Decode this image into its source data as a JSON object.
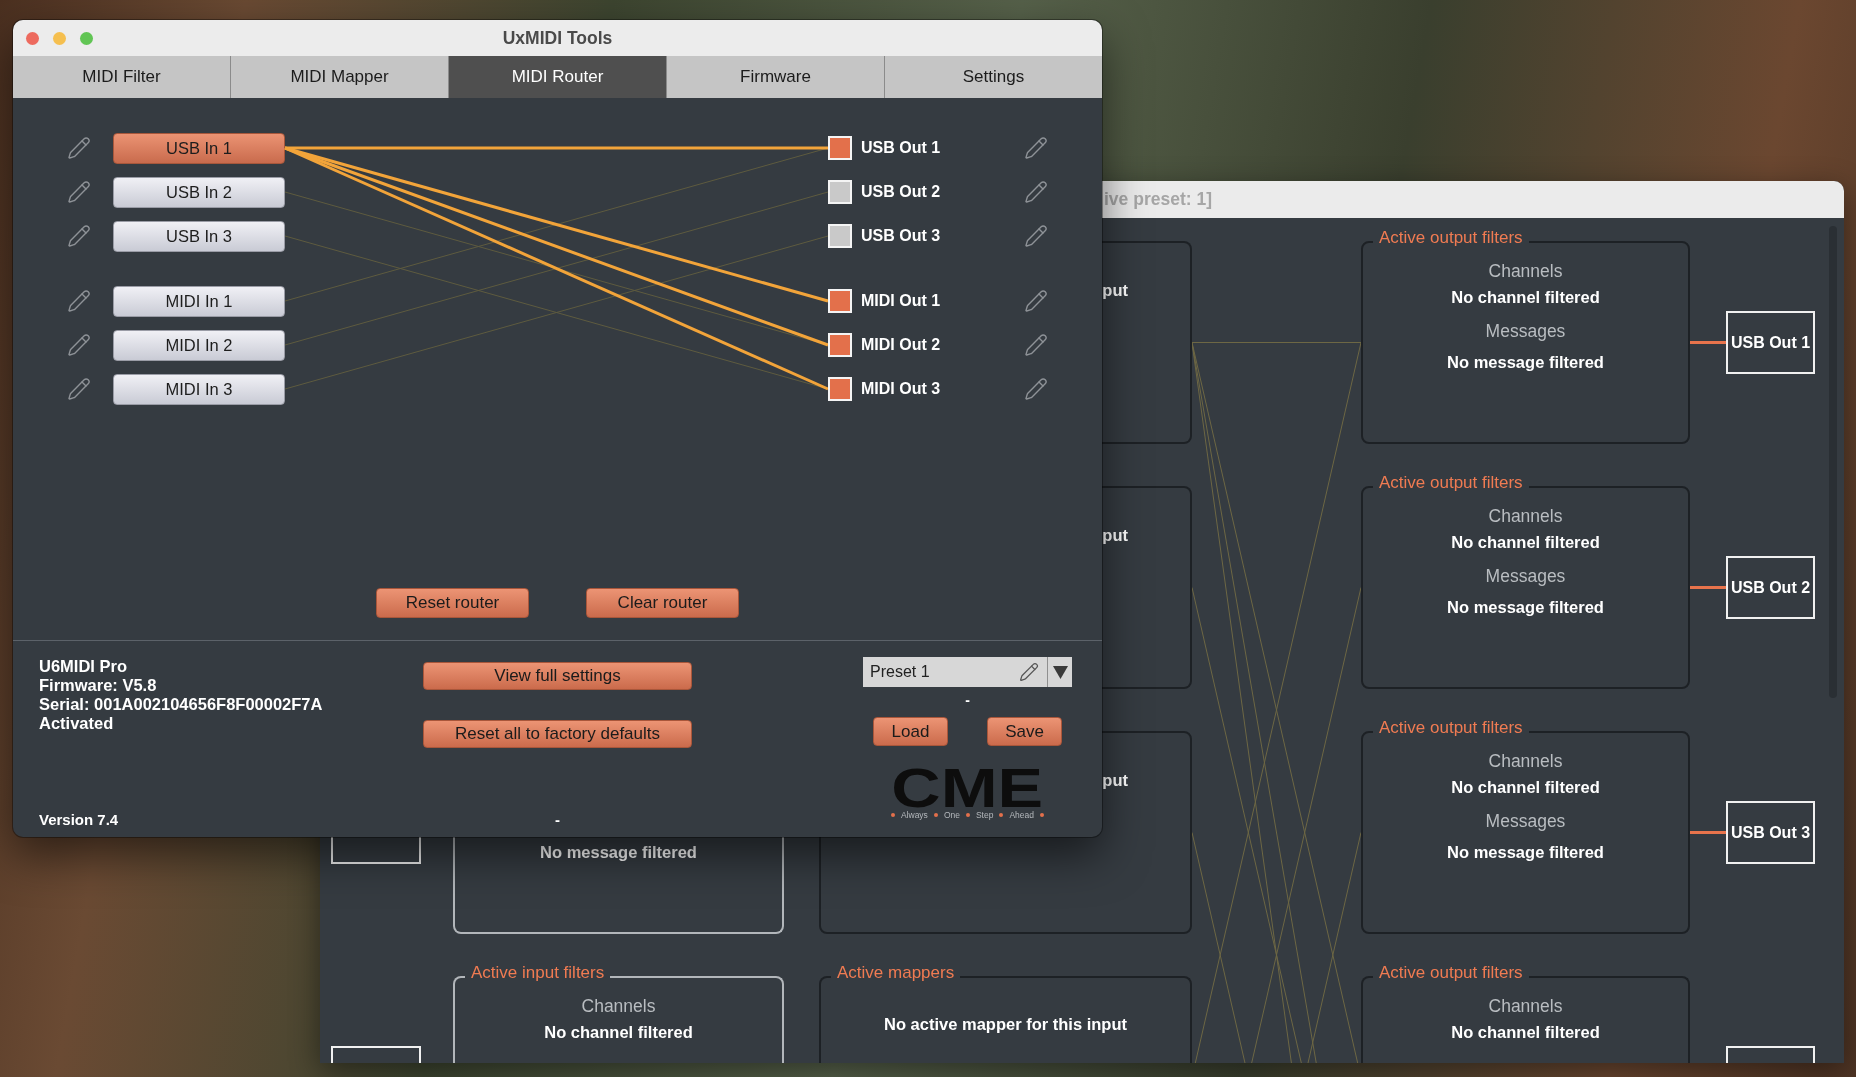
{
  "main_window": {
    "title": "UxMIDI Tools",
    "tabs": [
      {
        "label": "MIDI Filter",
        "selected": false
      },
      {
        "label": "MIDI Mapper",
        "selected": false
      },
      {
        "label": "MIDI Router",
        "selected": true
      },
      {
        "label": "Firmware",
        "selected": false
      },
      {
        "label": "Settings",
        "selected": false
      }
    ],
    "router": {
      "input_groups": [
        [
          {
            "label": "USB In 1",
            "selected": true
          },
          {
            "label": "USB In 2",
            "selected": false
          },
          {
            "label": "USB In 3",
            "selected": false
          }
        ],
        [
          {
            "label": "MIDI In 1",
            "selected": false
          },
          {
            "label": "MIDI In 2",
            "selected": false
          },
          {
            "label": "MIDI In 3",
            "selected": false
          }
        ]
      ],
      "output_groups": [
        [
          {
            "label": "USB Out 1",
            "checked": true
          },
          {
            "label": "USB Out 2",
            "checked": false
          },
          {
            "label": "USB Out 3",
            "checked": false
          }
        ],
        [
          {
            "label": "MIDI Out 1",
            "checked": true
          },
          {
            "label": "MIDI Out 2",
            "checked": true
          },
          {
            "label": "MIDI Out 3",
            "checked": true
          }
        ]
      ],
      "buttons": [
        "Reset router",
        "Clear router"
      ]
    },
    "device_info": [
      "U6MIDI Pro",
      "Firmware: V5.8",
      "Serial: 001A002104656F8F00002F7A",
      "Activated"
    ],
    "version": "Version 7.4",
    "actions": [
      "View full settings",
      "Reset all to factory defaults"
    ],
    "actions_status": "-",
    "preset": {
      "value": "Preset 1"
    },
    "preset_status": "-",
    "preset_buttons": [
      "Load",
      "Save"
    ],
    "logo": {
      "text": "CME",
      "tagline": [
        "Always",
        "One",
        "Step",
        "Ahead"
      ]
    }
  },
  "background_window": {
    "title": "ive preset: 1]",
    "rows": [
      {
        "mapper": {
          "kind": "covered",
          "text": "put"
        },
        "output_filter": {
          "title": "Active output filters",
          "channels_label": "Channels",
          "channels_value": "No channel filtered",
          "messages_label": "Messages",
          "messages_value": "No message filtered"
        },
        "output_node": {
          "kind": "labelled",
          "label": "USB Out 1"
        }
      },
      {
        "mapper": {
          "kind": "covered",
          "text": "put"
        },
        "output_filter": {
          "title": "Active output filters",
          "channels_label": "Channels",
          "channels_value": "No channel filtered",
          "messages_label": "Messages",
          "messages_value": "No message filtered"
        },
        "output_node": {
          "kind": "labelled",
          "label": "USB Out 2"
        }
      },
      {
        "input_node": {
          "kind": "covered"
        },
        "input_filter": {
          "kind": "covered",
          "messages_value": "No message filtered"
        },
        "mapper": {
          "kind": "covered",
          "text": "put"
        },
        "output_filter": {
          "title": "Active output filters",
          "channels_label": "Channels",
          "channels_value": "No channel filtered",
          "messages_label": "Messages",
          "messages_value": "No message filtered"
        },
        "output_node": {
          "kind": "labelled",
          "label": "USB Out 3"
        }
      },
      {
        "input_node": {
          "kind": "blank"
        },
        "input_filter": {
          "kind": "whole",
          "title": "Active input filters",
          "channels_label": "Channels",
          "channels_value": "No channel filtered"
        },
        "mapper": {
          "kind": "whole",
          "title": "Active mappers",
          "text": "No active mapper for this input"
        },
        "output_filter": {
          "title": "Active output filters",
          "channels_label": "Channels",
          "channels_value": "No channel filtered"
        },
        "output_node": {
          "kind": "blank"
        }
      }
    ]
  }
}
